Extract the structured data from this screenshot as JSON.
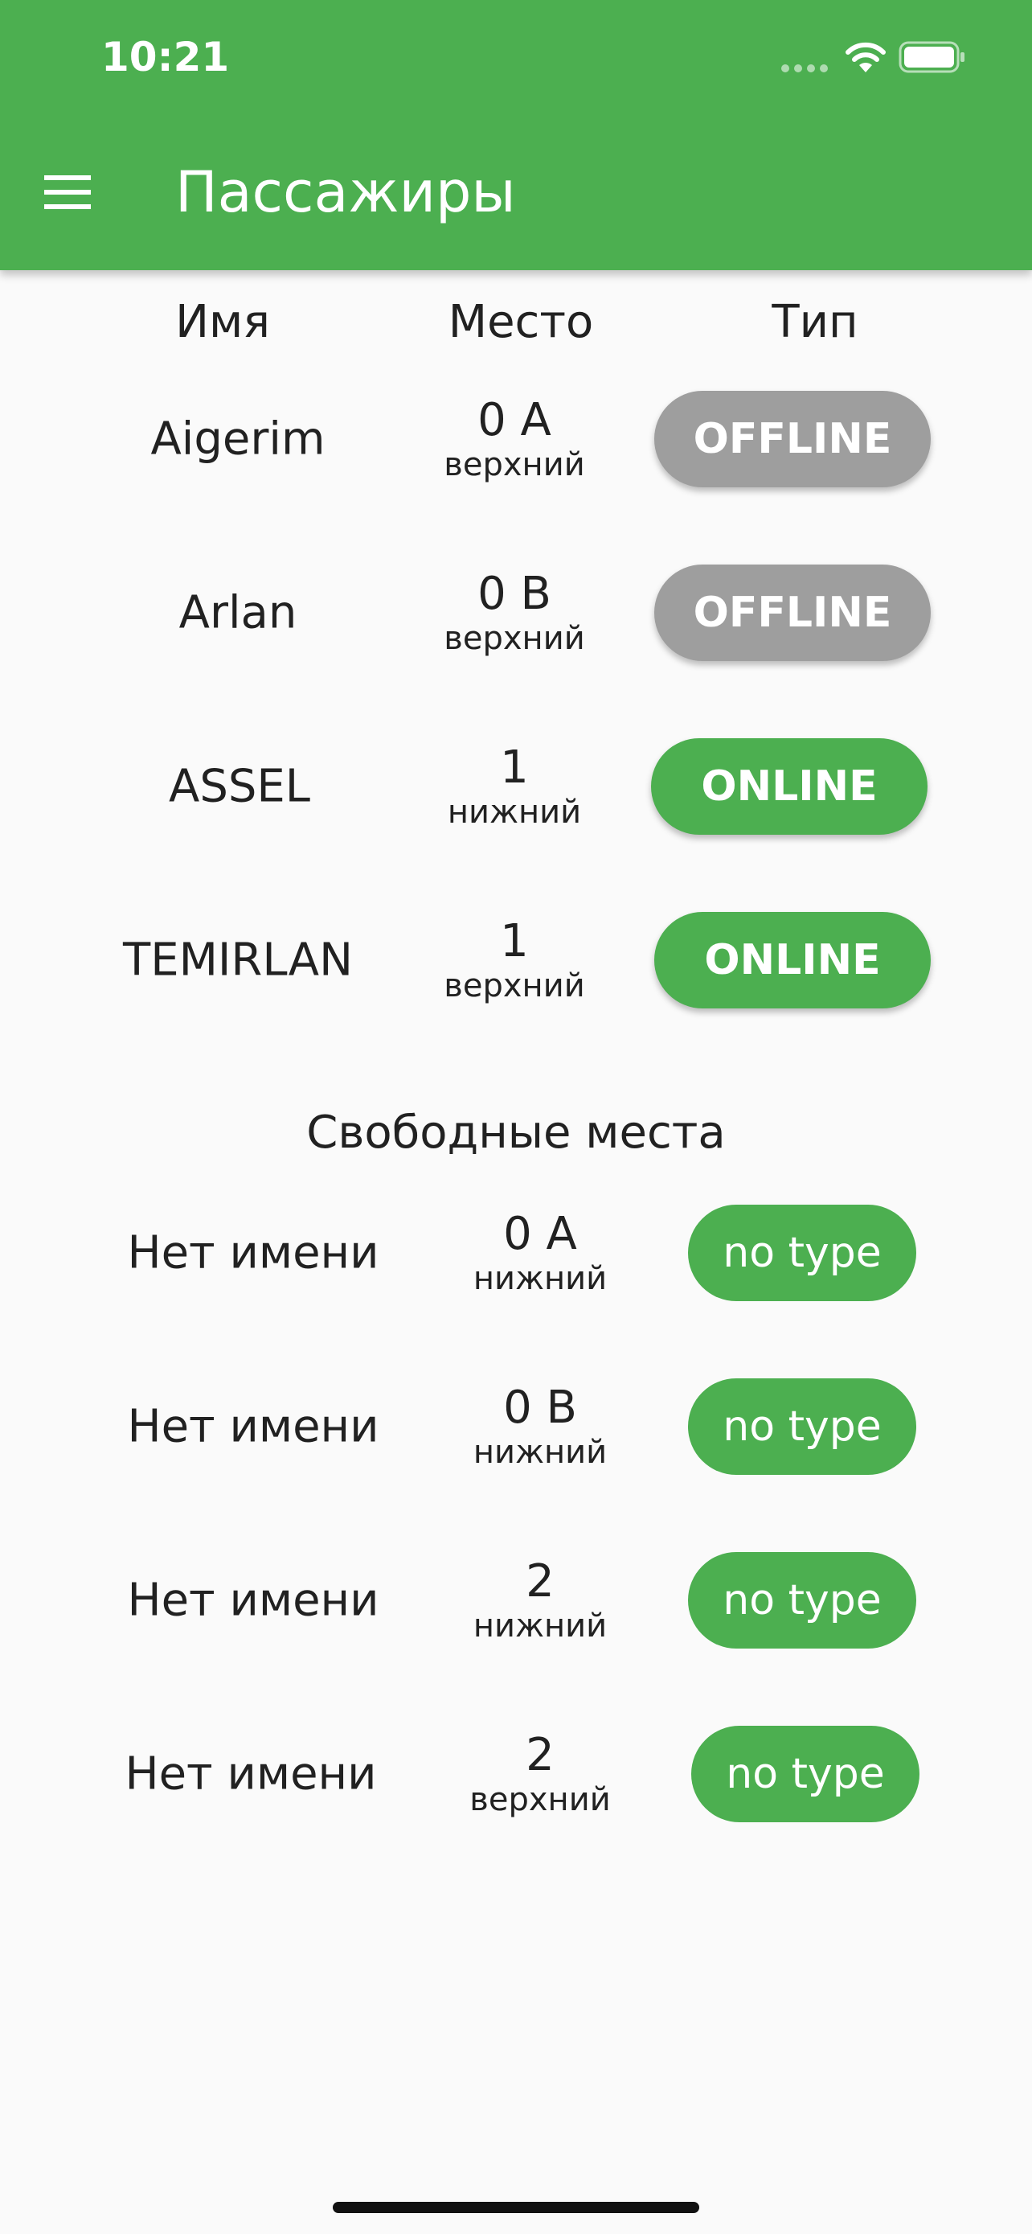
{
  "status_bar": {
    "time": "10:21"
  },
  "app_bar": {
    "title": "Пассажиры",
    "menu_icon": "hamburger-menu-icon"
  },
  "table_headers": {
    "name": "Имя",
    "seat": "Место",
    "type": "Тип"
  },
  "passengers": [
    {
      "name": "Aigerim",
      "seat": "0 A",
      "tier": "верхний",
      "type": "OFFLINE"
    },
    {
      "name": "Arlan",
      "seat": "0 B",
      "tier": "верхний",
      "type": "OFFLINE"
    },
    {
      "name": "ASSEL",
      "seat": "1",
      "tier": "нижний",
      "type": "ONLINE"
    },
    {
      "name": "TEMIRLAN",
      "seat": "1",
      "tier": "верхний",
      "type": "ONLINE"
    }
  ],
  "free_seats_title": "Свободные места",
  "free_seats": [
    {
      "name": "Нет имени",
      "seat": "0 A",
      "tier": "нижний",
      "type": "no type"
    },
    {
      "name": "Нет имени",
      "seat": "0 B",
      "tier": "нижний",
      "type": "no type"
    },
    {
      "name": "Нет имени",
      "seat": "2",
      "tier": "нижний",
      "type": "no type"
    },
    {
      "name": "Нет имени",
      "seat": "2",
      "tier": "верхний",
      "type": "no type"
    }
  ],
  "colors": {
    "primary": "#4caf50",
    "offline": "#9e9e9e",
    "background": "#fafafa",
    "text": "#212121"
  }
}
